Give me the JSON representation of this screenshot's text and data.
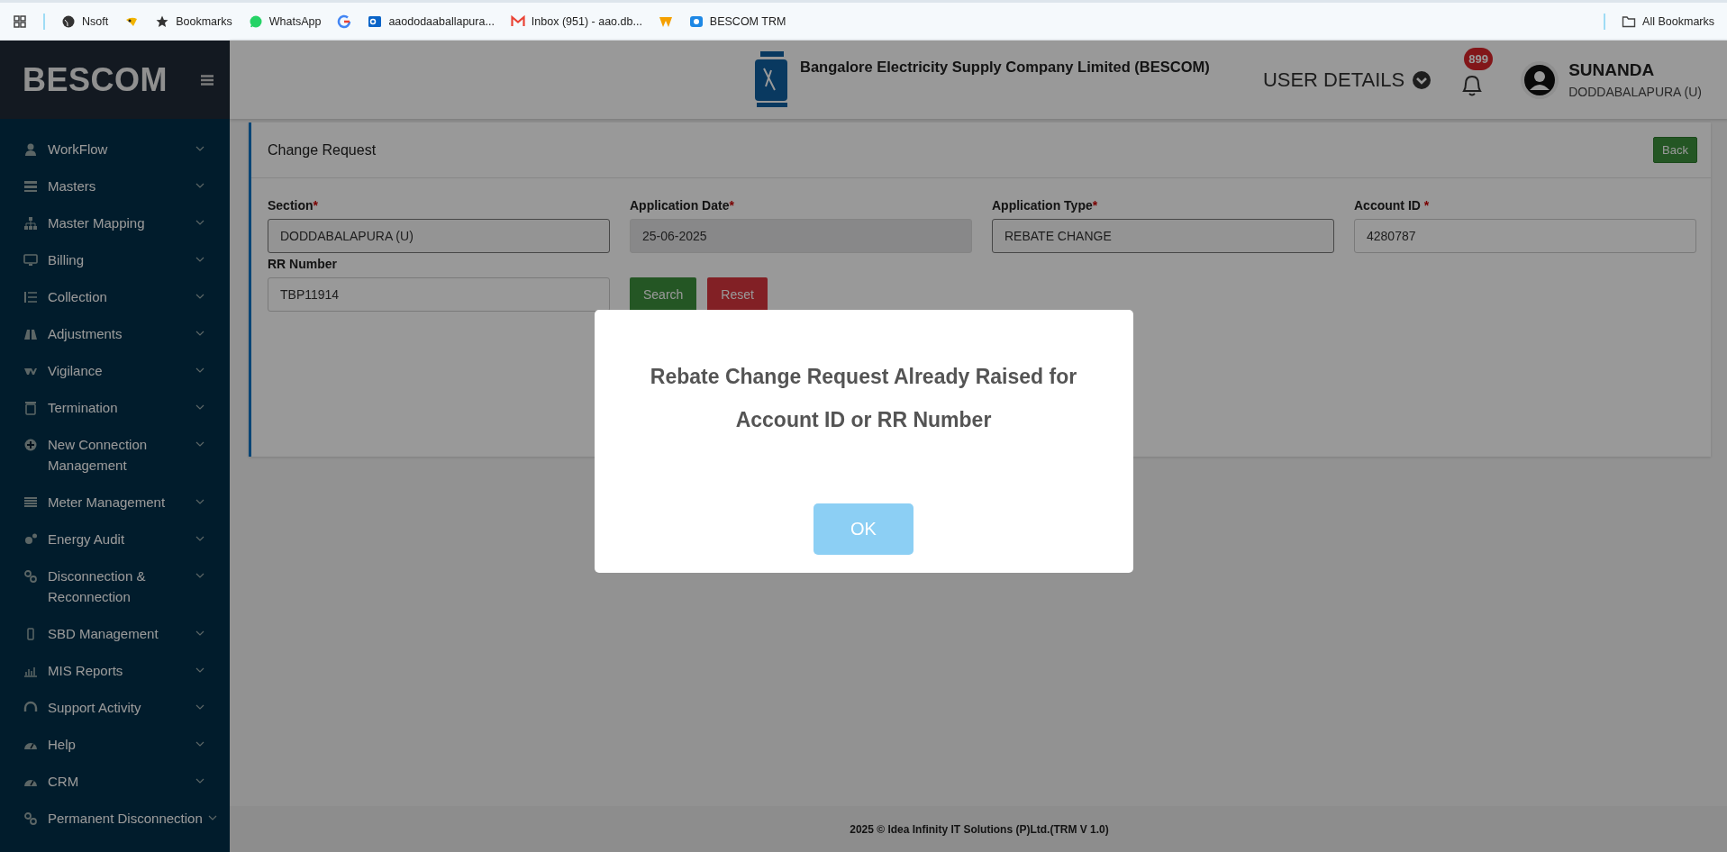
{
  "bookmarks_bar": {
    "items": [
      {
        "kind": "icon"
      },
      {
        "kind": "link",
        "label": "Nsoft"
      },
      {
        "kind": "icon"
      },
      {
        "kind": "link",
        "label": "Bookmarks"
      },
      {
        "kind": "link",
        "label": "WhatsApp"
      },
      {
        "kind": "icon"
      },
      {
        "kind": "link",
        "label": "aaododaaballapura..."
      },
      {
        "kind": "link",
        "label": "Inbox (951) - aao.db..."
      },
      {
        "kind": "icon"
      },
      {
        "kind": "link",
        "label": "BESCOM TRM"
      }
    ],
    "all_bookmarks": "All Bookmarks"
  },
  "sidebar": {
    "brand": "BESCOM",
    "items": [
      {
        "label": "WorkFlow"
      },
      {
        "label": "Masters"
      },
      {
        "label": "Master Mapping"
      },
      {
        "label": "Billing"
      },
      {
        "label": "Collection"
      },
      {
        "label": "Adjustments"
      },
      {
        "label": "Vigilance"
      },
      {
        "label": "Termination"
      },
      {
        "label": "New Connection Management"
      },
      {
        "label": "Meter Management"
      },
      {
        "label": "Energy Audit"
      },
      {
        "label": "Disconnection & Reconnection"
      },
      {
        "label": "SBD Management"
      },
      {
        "label": "MIS Reports"
      },
      {
        "label": "Support Activity"
      },
      {
        "label": "Help"
      },
      {
        "label": "CRM"
      },
      {
        "label": "Permanent Disconnection"
      }
    ]
  },
  "header": {
    "company": "Bangalore Electricity Supply Company Limited (BESCOM)",
    "user_details": "USER DETAILS",
    "notification_count": "899",
    "user_name": "SUNANDA",
    "user_section": "DODDABALAPURA (U)"
  },
  "form": {
    "title": "Change Request",
    "back": "Back",
    "fields": [
      {
        "label": "Section",
        "required_mark": "*",
        "kind": "select",
        "value": "DODDABALAPURA (U)",
        "disabled": false
      },
      {
        "label": "Application Date",
        "required_mark": "*",
        "kind": "text",
        "value": "25-06-2025",
        "disabled": true
      },
      {
        "label": "Application Type",
        "required_mark": "*",
        "kind": "select",
        "value": "REBATE CHANGE",
        "disabled": false
      },
      {
        "label": "Account ID",
        "required_mark": " *",
        "kind": "text",
        "value": "4280787",
        "disabled": false
      },
      {
        "label": "RR Number",
        "kind": "text",
        "value": "TBP11914",
        "disabled": false
      }
    ],
    "buttons": [
      {
        "label": "Search",
        "kind": "primary"
      },
      {
        "label": "Reset",
        "kind": "danger"
      }
    ]
  },
  "dialog": {
    "message": "Rebate Change Request Already Raised for Account ID or RR Number",
    "ok": "OK"
  },
  "footer": "2025 © Idea Infinity IT Solutions (P)Ltd.(TRM V 1.0)"
}
